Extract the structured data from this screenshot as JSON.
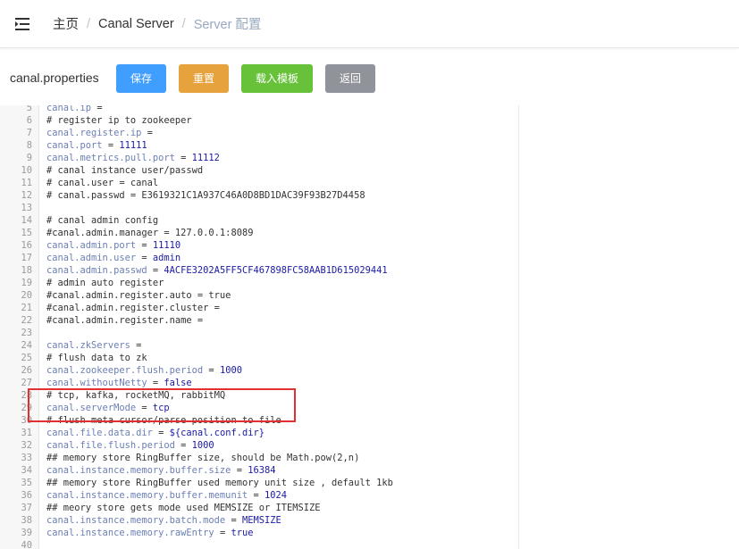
{
  "header": {
    "breadcrumb": [
      "主页",
      "Canal Server",
      "Server 配置"
    ],
    "separator": "/"
  },
  "toolbar": {
    "filename": "canal.properties",
    "save_label": "保存",
    "reset_label": "重置",
    "load_template_label": "载入模板",
    "back_label": "返回"
  },
  "colors": {
    "save": "#409eff",
    "reset": "#e6a23c",
    "load_template": "#67c23a",
    "back": "#909399",
    "highlight": "#e03030"
  },
  "editor": {
    "lines": [
      {
        "n": "5",
        "text": "canal.ip ="
      },
      {
        "n": "6",
        "text": "# register ip to zookeeper"
      },
      {
        "n": "7",
        "text": "canal.register.ip ="
      },
      {
        "n": "8",
        "text": "canal.port = 11111"
      },
      {
        "n": "9",
        "text": "canal.metrics.pull.port = 11112"
      },
      {
        "n": "10",
        "text": "# canal instance user/passwd"
      },
      {
        "n": "11",
        "text": "# canal.user = canal"
      },
      {
        "n": "12",
        "text": "# canal.passwd = E3619321C1A937C46A0D8BD1DAC39F93B27D4458"
      },
      {
        "n": "13",
        "text": ""
      },
      {
        "n": "14",
        "text": "# canal admin config"
      },
      {
        "n": "15",
        "text": "#canal.admin.manager = 127.0.0.1:8089"
      },
      {
        "n": "16",
        "text": "canal.admin.port = 11110"
      },
      {
        "n": "17",
        "text": "canal.admin.user = admin"
      },
      {
        "n": "18",
        "text": "canal.admin.passwd = 4ACFE3202A5FF5CF467898FC58AAB1D615029441"
      },
      {
        "n": "19",
        "text": "# admin auto register"
      },
      {
        "n": "20",
        "text": "#canal.admin.register.auto = true"
      },
      {
        "n": "21",
        "text": "#canal.admin.register.cluster ="
      },
      {
        "n": "22",
        "text": "#canal.admin.register.name ="
      },
      {
        "n": "23",
        "text": ""
      },
      {
        "n": "24",
        "text": "canal.zkServers ="
      },
      {
        "n": "25",
        "text": "# flush data to zk"
      },
      {
        "n": "26",
        "text": "canal.zookeeper.flush.period = 1000"
      },
      {
        "n": "27",
        "text": "canal.withoutNetty = false"
      },
      {
        "n": "28",
        "text": "# tcp, kafka, rocketMQ, rabbitMQ"
      },
      {
        "n": "29",
        "text": "canal.serverMode = tcp"
      },
      {
        "n": "30",
        "text": "# flush meta cursor/parse position to file"
      },
      {
        "n": "31",
        "text": "canal.file.data.dir = ${canal.conf.dir}"
      },
      {
        "n": "32",
        "text": "canal.file.flush.period = 1000"
      },
      {
        "n": "33",
        "text": "## memory store RingBuffer size, should be Math.pow(2,n)"
      },
      {
        "n": "34",
        "text": "canal.instance.memory.buffer.size = 16384"
      },
      {
        "n": "35",
        "text": "## memory store RingBuffer used memory unit size , default 1kb"
      },
      {
        "n": "36",
        "text": "canal.instance.memory.buffer.memunit = 1024"
      },
      {
        "n": "37",
        "text": "## meory store gets mode used MEMSIZE or ITEMSIZE"
      },
      {
        "n": "38",
        "text": "canal.instance.memory.batch.mode = MEMSIZE"
      },
      {
        "n": "39",
        "text": "canal.instance.memory.rawEntry = true"
      },
      {
        "n": "40",
        "text": ""
      }
    ]
  }
}
